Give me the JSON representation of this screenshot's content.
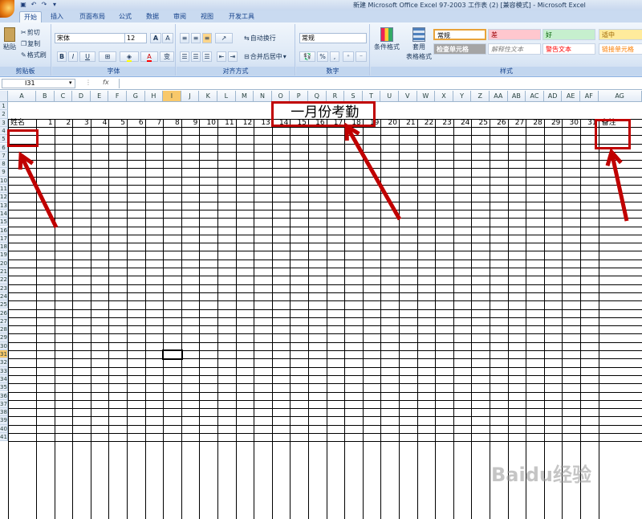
{
  "window": {
    "title": "新建 Microsoft Office Excel 97-2003 工作表 (2)  [兼容模式]  - Microsoft Excel"
  },
  "tabs": [
    {
      "label": "开始",
      "active": true
    },
    {
      "label": "插入",
      "active": false
    },
    {
      "label": "页面布局",
      "active": false
    },
    {
      "label": "公式",
      "active": false
    },
    {
      "label": "数据",
      "active": false
    },
    {
      "label": "审阅",
      "active": false
    },
    {
      "label": "视图",
      "active": false
    },
    {
      "label": "开发工具",
      "active": false
    }
  ],
  "ribbon": {
    "clipboard": {
      "label": "剪贴板",
      "paste": "粘贴",
      "cut": "剪切",
      "copy": "复制",
      "format_painter": "格式刷"
    },
    "font": {
      "label": "字体",
      "font_name": "宋体",
      "font_size": "12",
      "grow": "A",
      "shrink": "A",
      "bold": "B",
      "italic": "I",
      "underline": "U",
      "change_case": "变"
    },
    "alignment": {
      "label": "对齐方式",
      "wrap_text": "自动换行",
      "merge_center": "合并后居中"
    },
    "number": {
      "label": "数字",
      "format": "常规",
      "percent": "%",
      "comma": ","
    },
    "styles": {
      "label": "样式",
      "conditional_formatting": "条件格式",
      "format_as_table_1": "套用",
      "format_as_table_2": "表格格式",
      "cells": [
        {
          "text": "常规",
          "bg": "#ffffff",
          "fg": "#000000"
        },
        {
          "text": "差",
          "bg": "#ffc7ce",
          "fg": "#9c0006"
        },
        {
          "text": "好",
          "bg": "#c6efce",
          "fg": "#006100"
        },
        {
          "text": "适中",
          "bg": "#ffeb9c",
          "fg": "#9c6500"
        },
        {
          "text": "检查单元格",
          "bg": "#a5a5a5",
          "fg": "#ffffff"
        },
        {
          "text": "解释性文本",
          "bg": "#ffffff",
          "fg": "#7f7f7f"
        },
        {
          "text": "警告文本",
          "bg": "#ffffff",
          "fg": "#ff0000"
        },
        {
          "text": "链接单元格",
          "bg": "#ffffff",
          "fg": "#fa7d00"
        }
      ]
    }
  },
  "formula_bar": {
    "name_box": "I31",
    "fx": "fx",
    "value": ""
  },
  "sheet": {
    "columns": [
      "A",
      "B",
      "C",
      "D",
      "E",
      "F",
      "G",
      "H",
      "I",
      "J",
      "K",
      "L",
      "M",
      "N",
      "O",
      "P",
      "Q",
      "R",
      "S",
      "T",
      "U",
      "V",
      "W",
      "X",
      "Y",
      "Z",
      "AA",
      "AB",
      "AC",
      "AD",
      "AE",
      "AF",
      "AG"
    ],
    "active_column": "I",
    "active_row": 31,
    "row_count": 41,
    "title": "一月份考勤",
    "name_header": "姓名",
    "day_numbers": [
      "1",
      "2",
      "3",
      "4",
      "5",
      "6",
      "7",
      "8",
      "9",
      "10",
      "11",
      "12",
      "13",
      "14",
      "15",
      "16",
      "17",
      "18",
      "19",
      "20",
      "21",
      "22",
      "23",
      "24",
      "25",
      "26",
      "27",
      "28",
      "29",
      "30",
      "31"
    ],
    "remark_header": "备注"
  },
  "annotations": {
    "color": "#c00000"
  },
  "watermark": "Baidu经验"
}
